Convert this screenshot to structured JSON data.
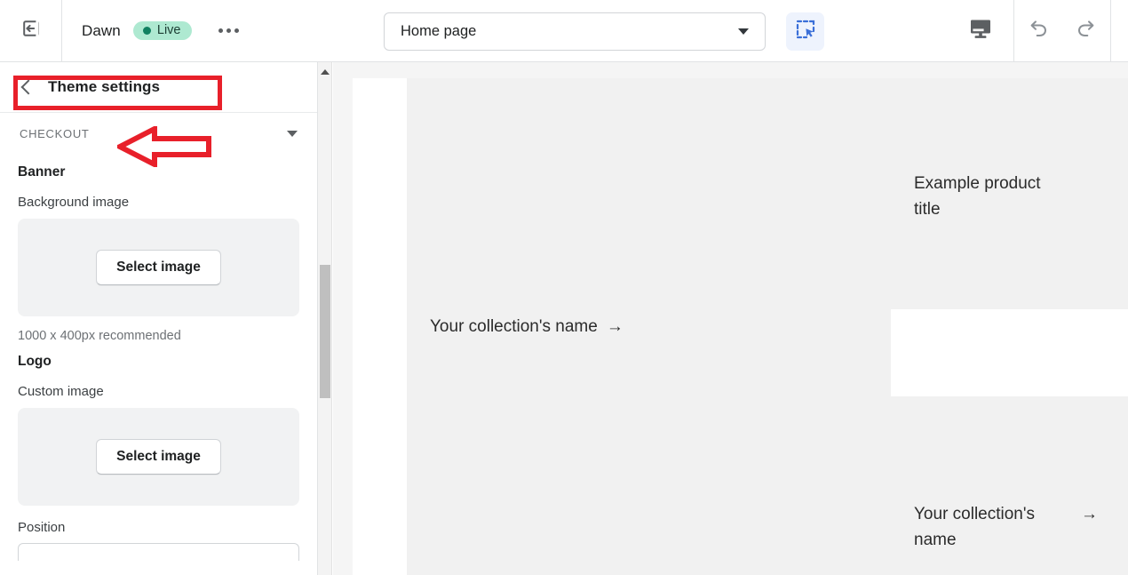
{
  "topbar": {
    "exit_icon": "exit-left-icon",
    "theme_name": "Dawn",
    "status_badge": "Live",
    "more_label": "more-options",
    "page_selector": {
      "value": "Home page",
      "caret_icon": "chevron-down-icon"
    },
    "select_tool_icon": "select-region-icon",
    "device_icon": "desktop-monitor-icon",
    "undo_icon": "undo-icon",
    "redo_icon": "redo-icon"
  },
  "sidebar": {
    "back_icon": "chevron-left-icon",
    "title": "Theme settings",
    "section": {
      "label": "CHECKOUT",
      "caret_icon": "chevron-down-icon"
    },
    "groups": [
      {
        "title": "Banner",
        "field_label": "Background image",
        "button_label": "Select image",
        "hint": "1000 x 400px recommended"
      },
      {
        "title": "Logo",
        "field_label": "Custom image",
        "button_label": "Select image",
        "next_field_label": "Position"
      }
    ],
    "scrollbar": {
      "up_arrow_icon": "scroll-up-arrow-icon",
      "thumb": "scrollbar-thumb"
    }
  },
  "preview": {
    "blocks": [
      {
        "text": "Your collection's name",
        "arrow": "→"
      },
      {
        "text": "Example product title",
        "arrow": ""
      },
      {
        "text": "Your collection's name",
        "arrow": "→"
      }
    ]
  },
  "annotations": {
    "highlight_color": "#e8202a",
    "box_target": "Theme settings",
    "arrow_target": "CHECKOUT"
  }
}
